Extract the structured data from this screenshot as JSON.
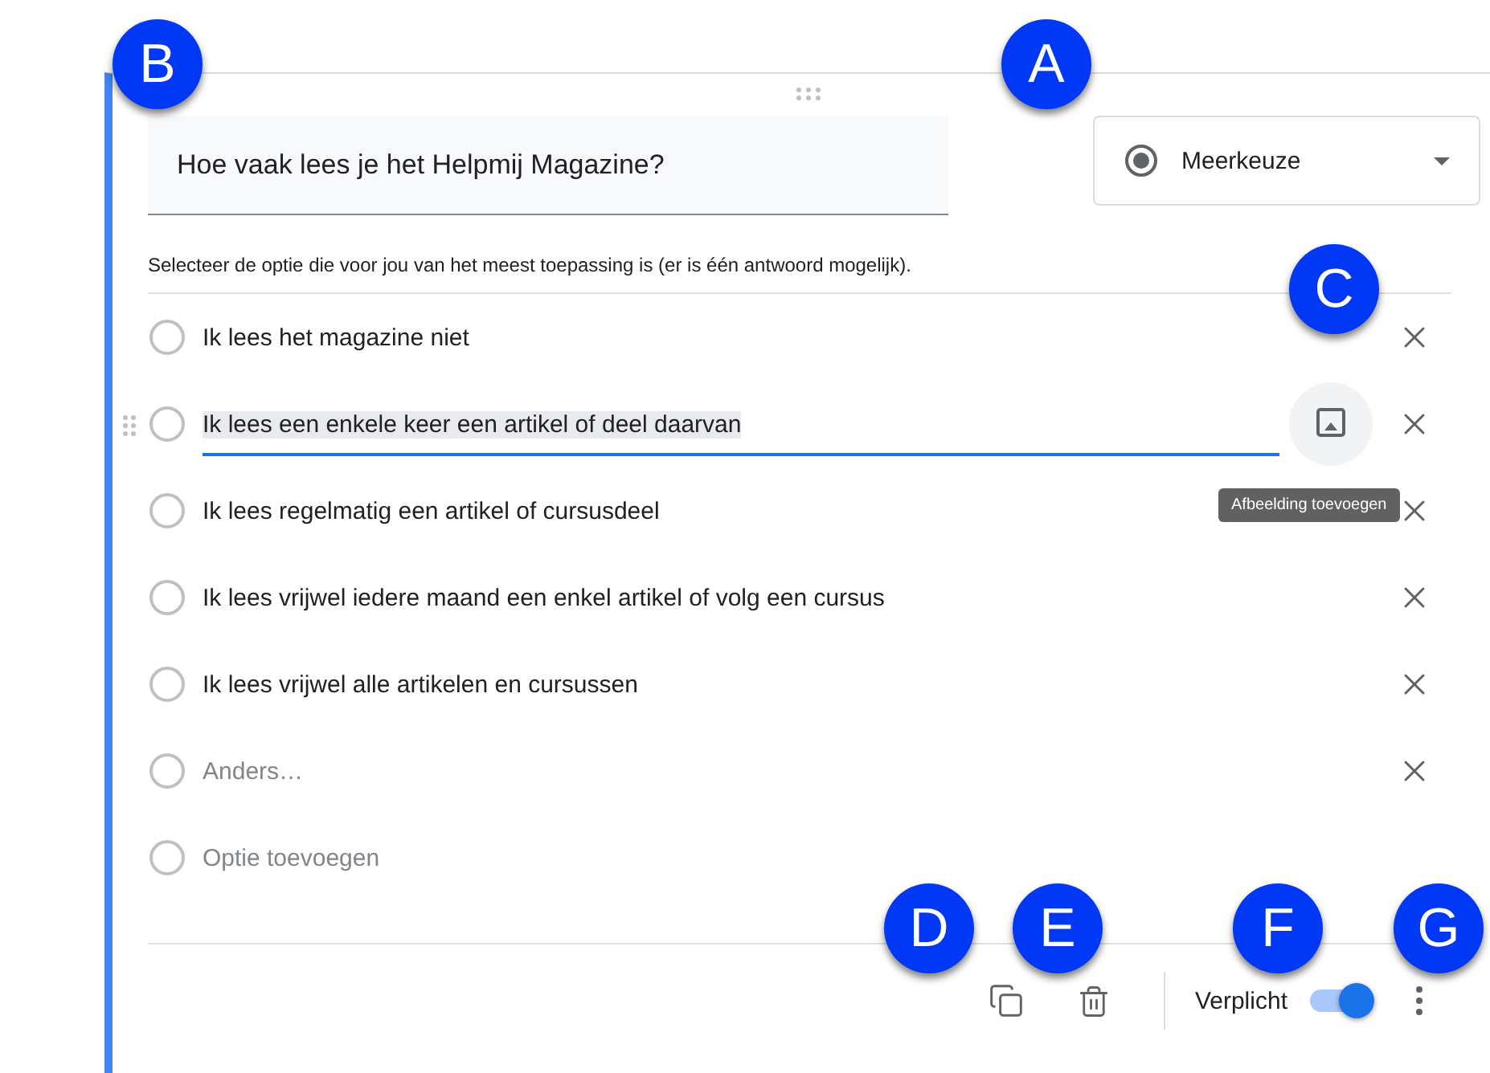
{
  "question": {
    "value": "Hoe vaak lees je het Helpmij Magazine?"
  },
  "type_select": {
    "label": "Meerkeuze"
  },
  "description": "Selecteer de optie die voor jou van het meest toepassing is (er is één antwoord mogelijk).",
  "options": [
    {
      "kind": "option",
      "label": "Ik lees het magazine niet",
      "focused": false,
      "checked": false
    },
    {
      "kind": "option",
      "label": "Ik lees een enkele keer een artikel of deel daarvan",
      "focused": true,
      "checked": false
    },
    {
      "kind": "option",
      "label": "Ik lees regelmatig een artikel of cursusdeel",
      "focused": false,
      "checked": false
    },
    {
      "kind": "option",
      "label": "Ik lees vrijwel iedere maand een enkel artikel of volg een cursus",
      "focused": false,
      "checked": false
    },
    {
      "kind": "option",
      "label": "Ik lees vrijwel alle artikelen en cursussen",
      "focused": false,
      "checked": false
    },
    {
      "kind": "other",
      "label": "Anders…",
      "focused": false,
      "checked": false
    },
    {
      "kind": "add",
      "label": "Optie toevoegen",
      "focused": false,
      "checked": false
    }
  ],
  "tooltip": "Afbeelding toevoegen",
  "footer": {
    "required_label": "Verplicht",
    "required": {
      "on": true
    }
  },
  "callouts": [
    "A",
    "B",
    "C",
    "D",
    "E",
    "F",
    "G"
  ]
}
